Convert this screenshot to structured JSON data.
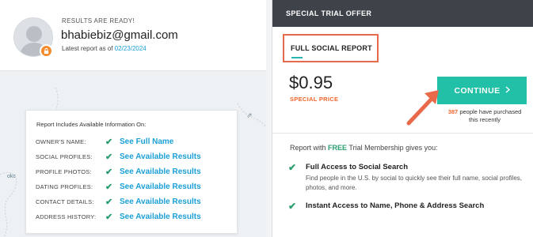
{
  "user": {
    "status": "RESULTS ARE READY!",
    "email": "bhabiebiz@gmail.com",
    "latest_prefix": "Latest report as of",
    "latest_date": "02/23/2024",
    "avatar_icon": "person-silhouette-icon",
    "badge_icon": "lock-icon"
  },
  "map": {
    "label": "okc"
  },
  "info_card": {
    "title": "Report Includes Available Information On:",
    "rows": [
      {
        "key": "OWNER'S NAME:",
        "value": "See Full Name"
      },
      {
        "key": "SOCIAL PROFILES:",
        "value": "See Available Results"
      },
      {
        "key": "PROFILE PHOTOS:",
        "value": "See Available Results"
      },
      {
        "key": "DATING PROFILES:",
        "value": "See Available Results"
      },
      {
        "key": "CONTACT DETAILS:",
        "value": "See Available Results"
      },
      {
        "key": "ADDRESS HISTORY:",
        "value": "See Available Results"
      }
    ]
  },
  "offer": {
    "header": "SPECIAL TRIAL OFFER",
    "tab_label": "FULL SOCIAL REPORT",
    "price": "$0.95",
    "price_label": "SPECIAL PRICE",
    "button_label": "CONTINUE",
    "button_icon": "chevron-right-icon",
    "purchased_count": "387",
    "purchased_text": "people have purchased this recently",
    "trial_prefix": "Report with",
    "trial_free": "FREE",
    "trial_suffix": "Trial Membership gives you:",
    "benefits": [
      {
        "title": "Full Access to Social Search",
        "desc": "Find people in the U.S. by social to quickly see their full name, social profiles, photos, and more."
      },
      {
        "title": "Instant Access to Name, Phone & Address Search",
        "desc": ""
      }
    ]
  },
  "colors": {
    "accent_teal": "#23c0a8",
    "link_blue": "#1a9fd6",
    "orange": "#f0652e",
    "check_green": "#2a9d6f",
    "header_dark": "#3e4349",
    "highlight_red": "#e86a4a"
  }
}
